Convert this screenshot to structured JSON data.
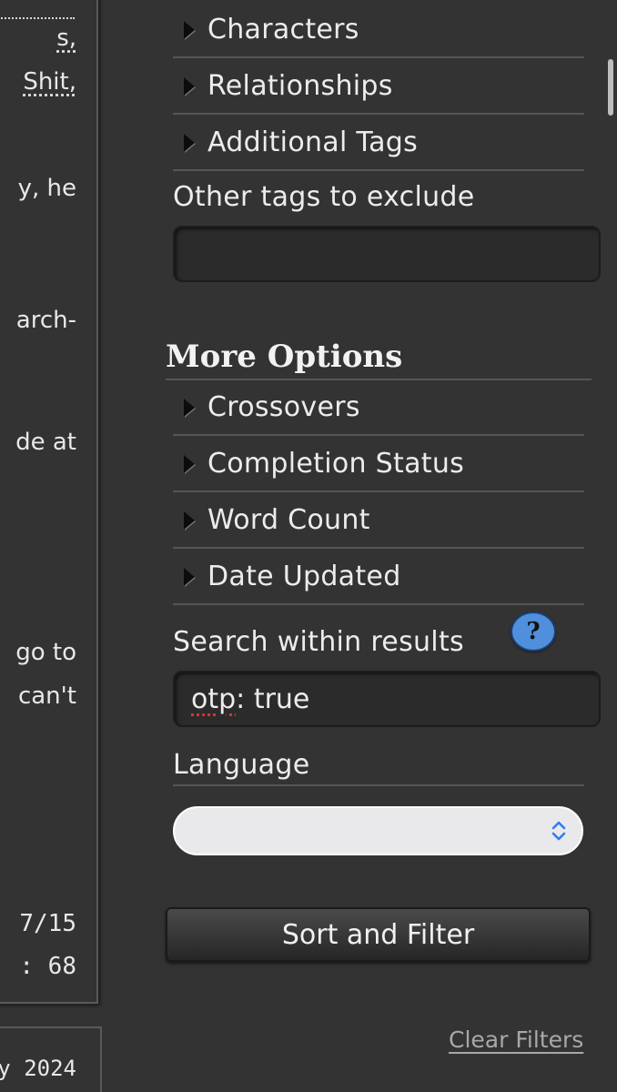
{
  "left_fragments": {
    "line1": "s,",
    "line2": "Shit,",
    "line3": "y, he",
    "line4": "arch-",
    "line5": "de at",
    "line6": "go to",
    "line7": "can't",
    "line8": "7/15",
    "line9": ": 68",
    "footer": "y 2024"
  },
  "include_tags": [
    {
      "label": "Characters"
    },
    {
      "label": "Relationships"
    },
    {
      "label": "Additional Tags"
    }
  ],
  "exclude": {
    "label": "Other tags to exclude",
    "value": ""
  },
  "more_options": {
    "heading": "More Options",
    "items": [
      {
        "label": "Crossovers"
      },
      {
        "label": "Completion Status"
      },
      {
        "label": "Word Count"
      },
      {
        "label": "Date Updated"
      }
    ]
  },
  "search_within": {
    "label": "Search within results",
    "help_symbol": "?",
    "value_word1": "otp",
    "value_rest": ": true"
  },
  "language": {
    "label": "Language",
    "selected": ""
  },
  "submit_label": "Sort and Filter",
  "clear_label": "Clear Filters",
  "colors": {
    "background": "#333333",
    "help_blue": "#4f8fdc",
    "select_chevron": "#3478f6"
  }
}
